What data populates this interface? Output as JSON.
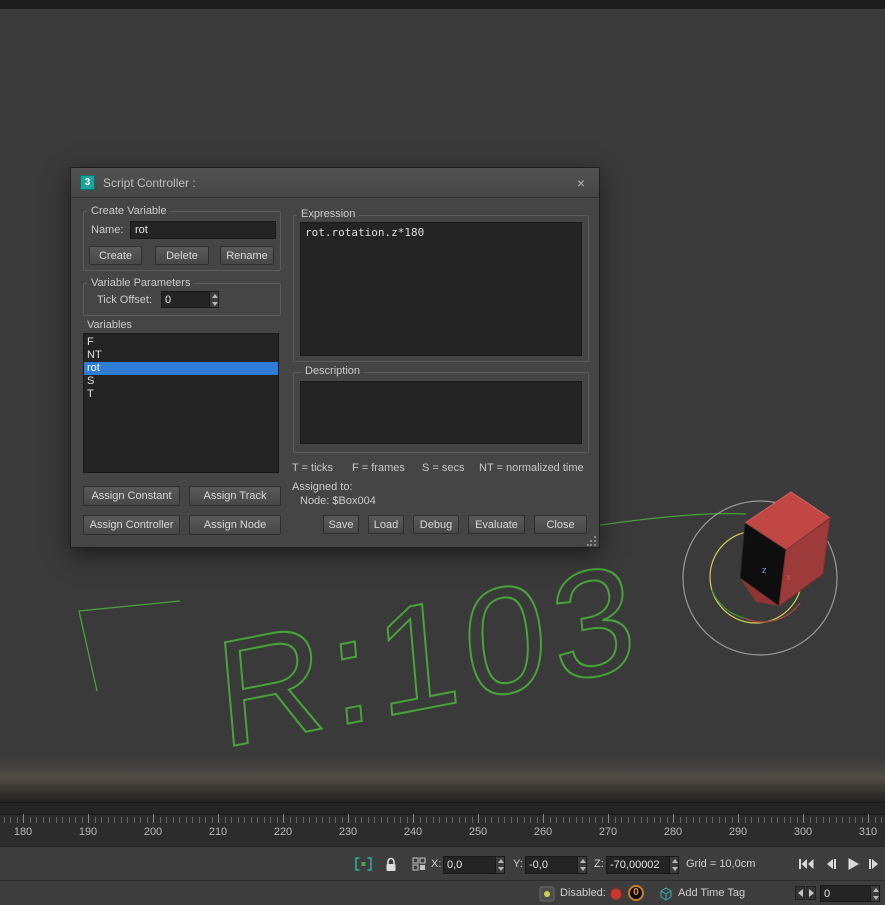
{
  "window": {
    "title": "Script Controller :",
    "app_icon_text": "3",
    "close_glyph": "×"
  },
  "dialog": {
    "groups": {
      "create_variable": "Create Variable",
      "variable_parameters": "Variable Parameters",
      "variables": "Variables",
      "expression": "Expression",
      "description": "Description"
    },
    "name_label": "Name:",
    "name_value": "rot",
    "create_buttons": [
      "Create",
      "Delete",
      "Rename"
    ],
    "tick_offset_label": "Tick Offset:",
    "tick_offset_value": "0",
    "variables_list": [
      "F",
      "NT",
      "rot",
      "S",
      "T"
    ],
    "variables_selected": "rot",
    "assign_buttons": [
      "Assign Constant",
      "Assign Track",
      "Assign Controller",
      "Assign Node"
    ],
    "expression_value": "rot.rotation.z*180",
    "description_value": "",
    "legend": [
      "T = ticks",
      "F = frames",
      "S = secs",
      "NT = normalized time"
    ],
    "assigned_to_label": "Assigned to:",
    "assigned_node": "Node: $Box004",
    "action_buttons": [
      "Save",
      "Load",
      "Debug",
      "Evaluate",
      "Close"
    ]
  },
  "viewport": {
    "rotation_readout": "R:103",
    "axis_z": "z",
    "axis_x": "x",
    "colors": {
      "wireframe_green": "#49a33b",
      "box_red": "#c14745",
      "gizmo_gray": "#999999",
      "gizmo_yellow": "#cfcf52",
      "selection_blue": "#2e7cd6"
    }
  },
  "timeline": {
    "labels": [
      "180",
      "190",
      "200",
      "210",
      "220",
      "230",
      "240",
      "250",
      "260",
      "270",
      "280",
      "290",
      "300",
      "310"
    ]
  },
  "statusbar": {
    "x_label": "X:",
    "x_value": "0,0",
    "y_label": "Y:",
    "y_value": "-0,0",
    "z_label": "Z:",
    "z_value": "-70,00002",
    "grid_label": "Grid = 10,0cm",
    "disabled_label": "Disabled:",
    "zero_badge": "0",
    "add_time_tag_label": "Add Time Tag",
    "frame_value": "0"
  }
}
